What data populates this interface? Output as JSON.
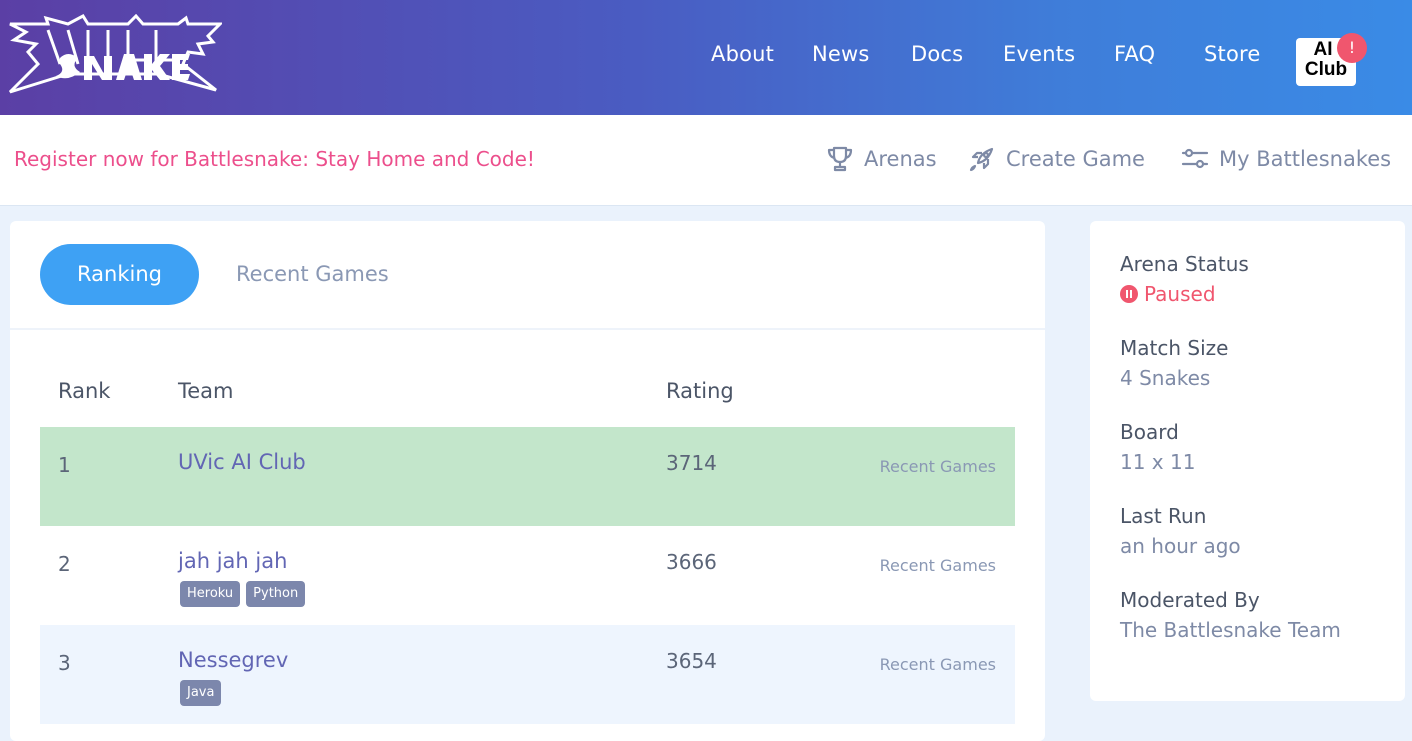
{
  "header": {
    "logo_text": "BATTLESNAKE",
    "nav": [
      {
        "label": "About"
      },
      {
        "label": "News"
      },
      {
        "label": "Docs"
      },
      {
        "label": "Events"
      },
      {
        "label": "FAQ"
      },
      {
        "label": "Store"
      }
    ],
    "ai_club": {
      "line1": "AI",
      "line2": "Club",
      "badge": "!"
    }
  },
  "subbar": {
    "register_text": "Register now for Battlesnake: Stay Home and Code!",
    "links": [
      {
        "label": "Arenas",
        "icon": "trophy-icon"
      },
      {
        "label": "Create Game",
        "icon": "rocket-icon"
      },
      {
        "label": "My Battlesnakes",
        "icon": "sliders-icon"
      }
    ]
  },
  "tabs": [
    {
      "label": "Ranking",
      "active": true
    },
    {
      "label": "Recent Games",
      "active": false
    }
  ],
  "table": {
    "columns": [
      "Rank",
      "Team",
      "Rating"
    ],
    "rows": [
      {
        "rank": "1",
        "team": "UVic AI Club",
        "rating": "3714",
        "link": "Recent Games",
        "tags": [],
        "highlight": "#c3e6cb"
      },
      {
        "rank": "2",
        "team": "jah jah jah",
        "rating": "3666",
        "link": "Recent Games",
        "tags": [
          "Heroku",
          "Python"
        ],
        "highlight": "#ffffff"
      },
      {
        "rank": "3",
        "team": "Nessegrev",
        "rating": "3654",
        "link": "Recent Games",
        "tags": [
          "Java"
        ],
        "highlight": "#eef5fe"
      }
    ]
  },
  "arena_info": {
    "status_label": "Arena Status",
    "status_value": "Paused",
    "match_size_label": "Match Size",
    "match_size_value": "4 Snakes",
    "board_label": "Board",
    "board_value": "11 x 11",
    "last_run_label": "Last Run",
    "last_run_value": "an hour ago",
    "moderated_label": "Moderated By",
    "moderated_value": "The Battlesnake Team"
  },
  "colors": {
    "accent": "#3ea1f4",
    "register": "#ec4f8c",
    "paused": "#f0566e",
    "winner_row": "#c3e6cb"
  }
}
